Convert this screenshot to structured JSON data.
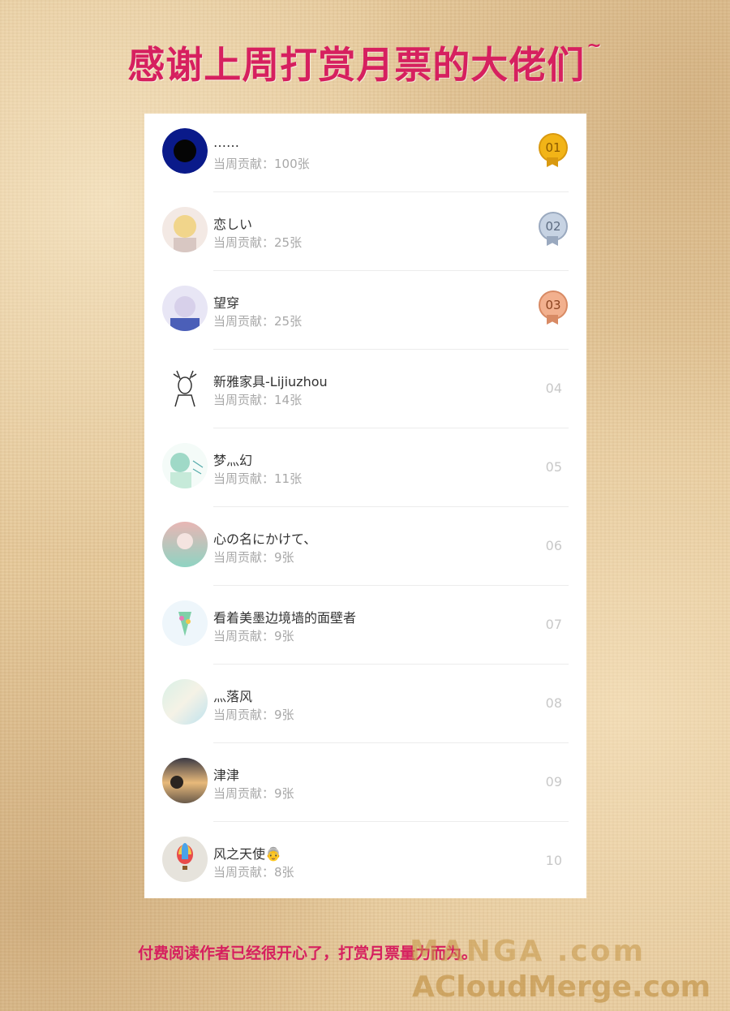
{
  "title": {
    "text": "感谢上周打赏月票的大佬们",
    "tilde": "~"
  },
  "leaderboard": {
    "rows": [
      {
        "name": "……",
        "contribution": "当周贡献：100张",
        "rank": "01",
        "medal": "gold"
      },
      {
        "name": "恋しい",
        "contribution": "当周贡献：25张",
        "rank": "02",
        "medal": "silver"
      },
      {
        "name": "望穿",
        "contribution": "当周贡献：25张",
        "rank": "03",
        "medal": "bronze"
      },
      {
        "name": "新雅家具-Lijiuzhou",
        "contribution": "当周贡献：14张",
        "rank": "04"
      },
      {
        "name": "梦灬幻",
        "contribution": "当周贡献：11张",
        "rank": "05"
      },
      {
        "name": "心の名にかけて、",
        "contribution": "当周贡献：9张",
        "rank": "06"
      },
      {
        "name": "看着美墨边境墙的面壁者",
        "contribution": "当周贡献：9张",
        "rank": "07"
      },
      {
        "name": "灬落风",
        "contribution": "当周贡献：9张",
        "rank": "08"
      },
      {
        "name": "津津",
        "contribution": "当周贡献：9张",
        "rank": "09"
      },
      {
        "name": "风之天使👵",
        "contribution": "当周贡献：8张",
        "rank": "10"
      }
    ]
  },
  "footer": {
    "text": "付费阅读作者已经很开心了，打赏月票量力而为。"
  },
  "watermark": {
    "line1": "MANGA .com",
    "line2": "ACloudMerge.com"
  },
  "colors": {
    "title": "#d6205f",
    "card": "#ffffff",
    "gold": "#f2b417",
    "silver": "#c7d3e3",
    "bronze": "#f2b08e"
  }
}
